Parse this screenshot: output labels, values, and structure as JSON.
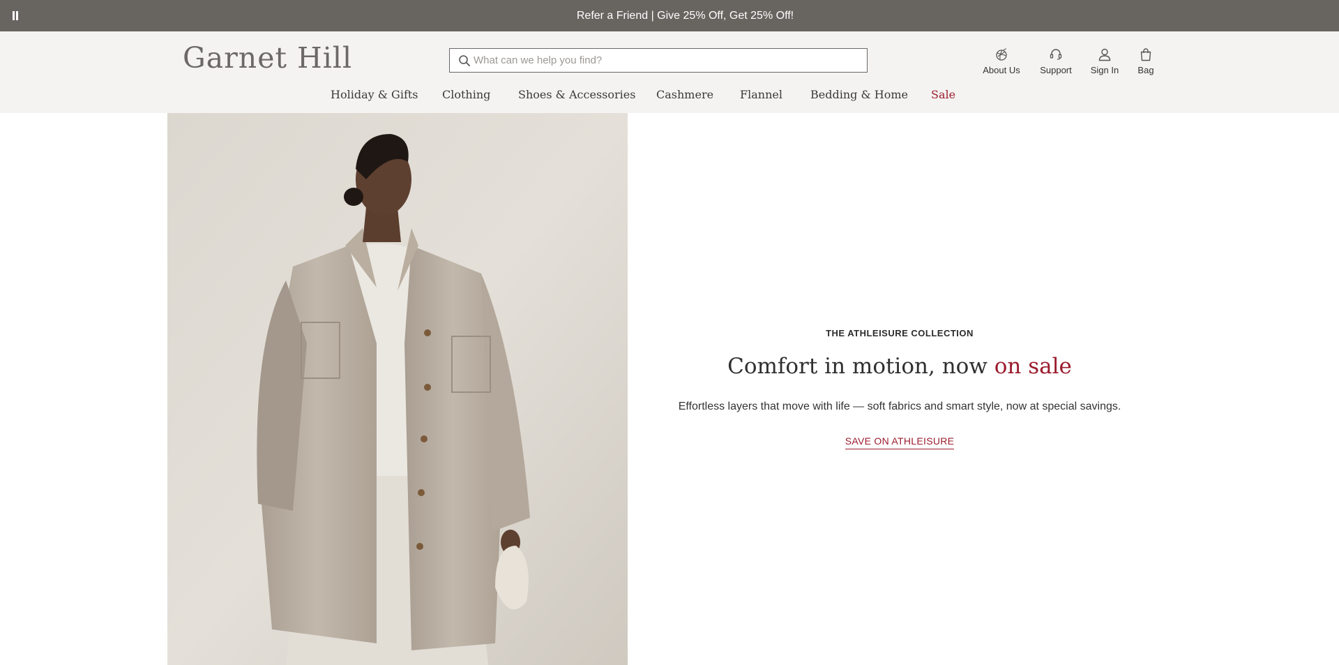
{
  "promo": {
    "text": "Refer a Friend | Give 25% Off, Get 25% Off!"
  },
  "header": {
    "logo": "Garnet Hill",
    "search": {
      "placeholder": "What can we help you find?"
    },
    "utility": [
      {
        "label": "About Us",
        "icon": "yarn-ball-icon"
      },
      {
        "label": "Support",
        "icon": "headset-icon"
      },
      {
        "label": "Sign In",
        "icon": "user-icon"
      },
      {
        "label": "Bag",
        "icon": "bag-icon"
      }
    ]
  },
  "nav": {
    "items": [
      {
        "label": "Holiday & Gifts"
      },
      {
        "label": "Clothing"
      },
      {
        "label": "Shoes & Accessories"
      },
      {
        "label": "Cashmere"
      },
      {
        "label": "Flannel"
      },
      {
        "label": "Bedding & Home"
      },
      {
        "label": "Sale"
      }
    ]
  },
  "hero": {
    "eyebrow": "THE ATHLEISURE COLLECTION",
    "headline_main": "Comfort in motion, now ",
    "headline_accent": "on sale",
    "subcopy": "Effortless layers that move with life — soft fabrics and smart style, now at special savings.",
    "cta": "SAVE ON ATHLEISURE"
  },
  "colors": {
    "promo_bg": "#686460",
    "header_bg": "#f4f3f1",
    "accent_red": "#9b1c2e",
    "text_dark": "#2f2f2f"
  }
}
